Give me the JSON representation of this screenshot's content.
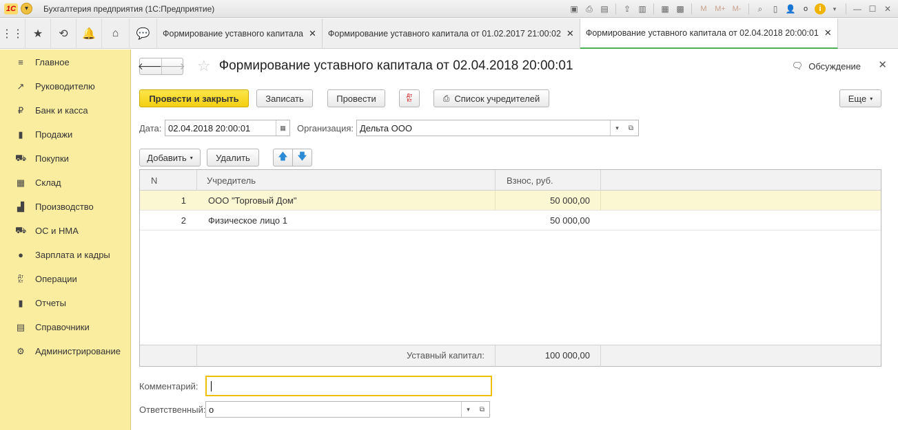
{
  "app": {
    "title": "Бухгалтерия предприятия  (1С:Предприятие)",
    "logo": "1С",
    "toolbar": [
      "M",
      "M+",
      "M-"
    ],
    "user": "о"
  },
  "tabs": [
    {
      "label": "Формирование уставного капитала"
    },
    {
      "label": "Формирование уставного капитала от 01.02.2017 21:00:02"
    },
    {
      "label": "Формирование уставного капитала от 02.04.2018 20:00:01"
    }
  ],
  "sidebar": {
    "items": [
      {
        "label": "Главное",
        "icon": "≡"
      },
      {
        "label": "Руководителю",
        "icon": "↗"
      },
      {
        "label": "Банк и касса",
        "icon": "₽"
      },
      {
        "label": "Продажи",
        "icon": "▮"
      },
      {
        "label": "Покупки",
        "icon": "⛟"
      },
      {
        "label": "Склад",
        "icon": "▦"
      },
      {
        "label": "Производство",
        "icon": "▟"
      },
      {
        "label": "ОС и НМА",
        "icon": "⛟"
      },
      {
        "label": "Зарплата и кадры",
        "icon": "●"
      },
      {
        "label": "Операции",
        "icon": "Дт Кт"
      },
      {
        "label": "Отчеты",
        "icon": "▮"
      },
      {
        "label": "Справочники",
        "icon": "▤"
      },
      {
        "label": "Администрирование",
        "icon": "⚙"
      }
    ]
  },
  "form": {
    "title": "Формирование уставного капитала от 02.04.2018 20:00:01",
    "discussion": "Обсуждение",
    "buttons": {
      "post_close": "Провести и закрыть",
      "save": "Записать",
      "post": "Провести",
      "dtkt_top": "Дт",
      "dtkt_bottom": "Кт",
      "founders_list": "Список учредителей",
      "more": "Еще"
    },
    "date_label": "Дата:",
    "date_value": "02.04.2018 20:00:01",
    "org_label": "Организация:",
    "org_value": "Дельта ООО",
    "table_buttons": {
      "add": "Добавить",
      "delete": "Удалить"
    },
    "table": {
      "columns": [
        "N",
        "Учредитель",
        "Взнос, руб."
      ],
      "rows": [
        {
          "n": "1",
          "founder": "ООО \"Торговый Дом\"",
          "amount": "50 000,00"
        },
        {
          "n": "2",
          "founder": "Физическое лицо 1",
          "amount": "50 000,00"
        }
      ],
      "footer_label": "Уставный капитал:",
      "footer_total": "100 000,00"
    },
    "comment_label": "Комментарий:",
    "comment_value": "",
    "responsible_label": "Ответственный:",
    "responsible_value": "о"
  }
}
